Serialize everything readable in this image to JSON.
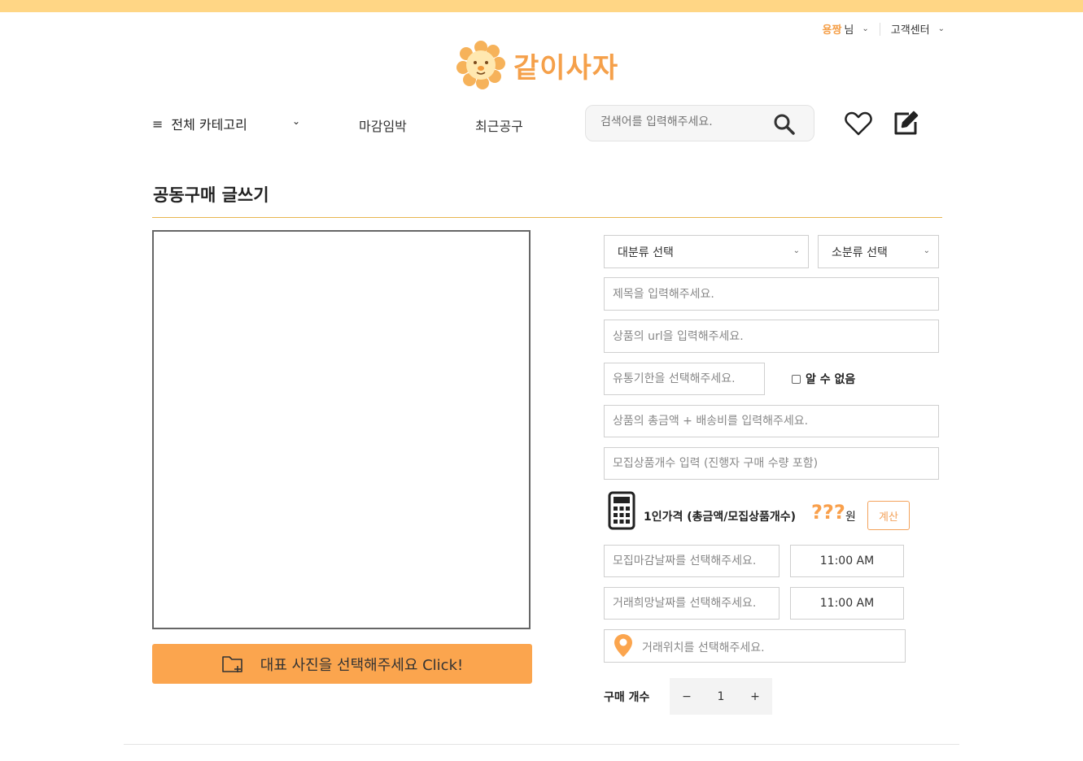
{
  "header": {
    "user_name": "용짱",
    "user_suffix": "님",
    "customer_center": "고객센터",
    "logo_text": "같이사자"
  },
  "nav": {
    "all_category": "전체 카테고리",
    "menu": [
      "마감임박",
      "최근공구"
    ],
    "search_placeholder": "검색어를 입력해주세요."
  },
  "page": {
    "title": "공동구매 글쓰기"
  },
  "photo": {
    "button_label": "대표 사진을 선택해주세요 Click!"
  },
  "form": {
    "major_category": "대분류 선택",
    "minor_category": "소분류 선택",
    "title_placeholder": "제목을 입력해주세요.",
    "url_placeholder": "상품의 url을 입력해주세요.",
    "expiry_placeholder": "유통기한을 선택해주세요.",
    "unknown_label": "알 수 없음",
    "total_placeholder": "상품의 총금액 + 배송비를 입력해주세요.",
    "count_placeholder": "모집상품개수 입력 (진행자 구매 수량 포함)",
    "per_person_label": "1인가격 (총금액/모집상품개수)",
    "per_person_price": "???",
    "won": "원",
    "calc_button": "계산",
    "deadline_placeholder": "모집마감날짜를 선택해주세요.",
    "deadline_time": "11:00 AM",
    "trade_date_placeholder": "거래희망날짜를 선택해주세요.",
    "trade_time": "11:00 AM",
    "location_placeholder": "거래위치를 선택해주세요.",
    "qty_label": "구매 개수",
    "qty_minus": "−",
    "qty_value": "1",
    "qty_plus": "+"
  },
  "colors": {
    "accent": "#fba54e",
    "topbar": "#ffd685",
    "divider": "#e8b650"
  },
  "icons": [
    "menu-icon",
    "chevron-down-icon",
    "search-icon",
    "heart-icon",
    "edit-icon",
    "folder-add-icon",
    "calculator-icon",
    "location-pin-icon",
    "lion-logo-icon"
  ]
}
